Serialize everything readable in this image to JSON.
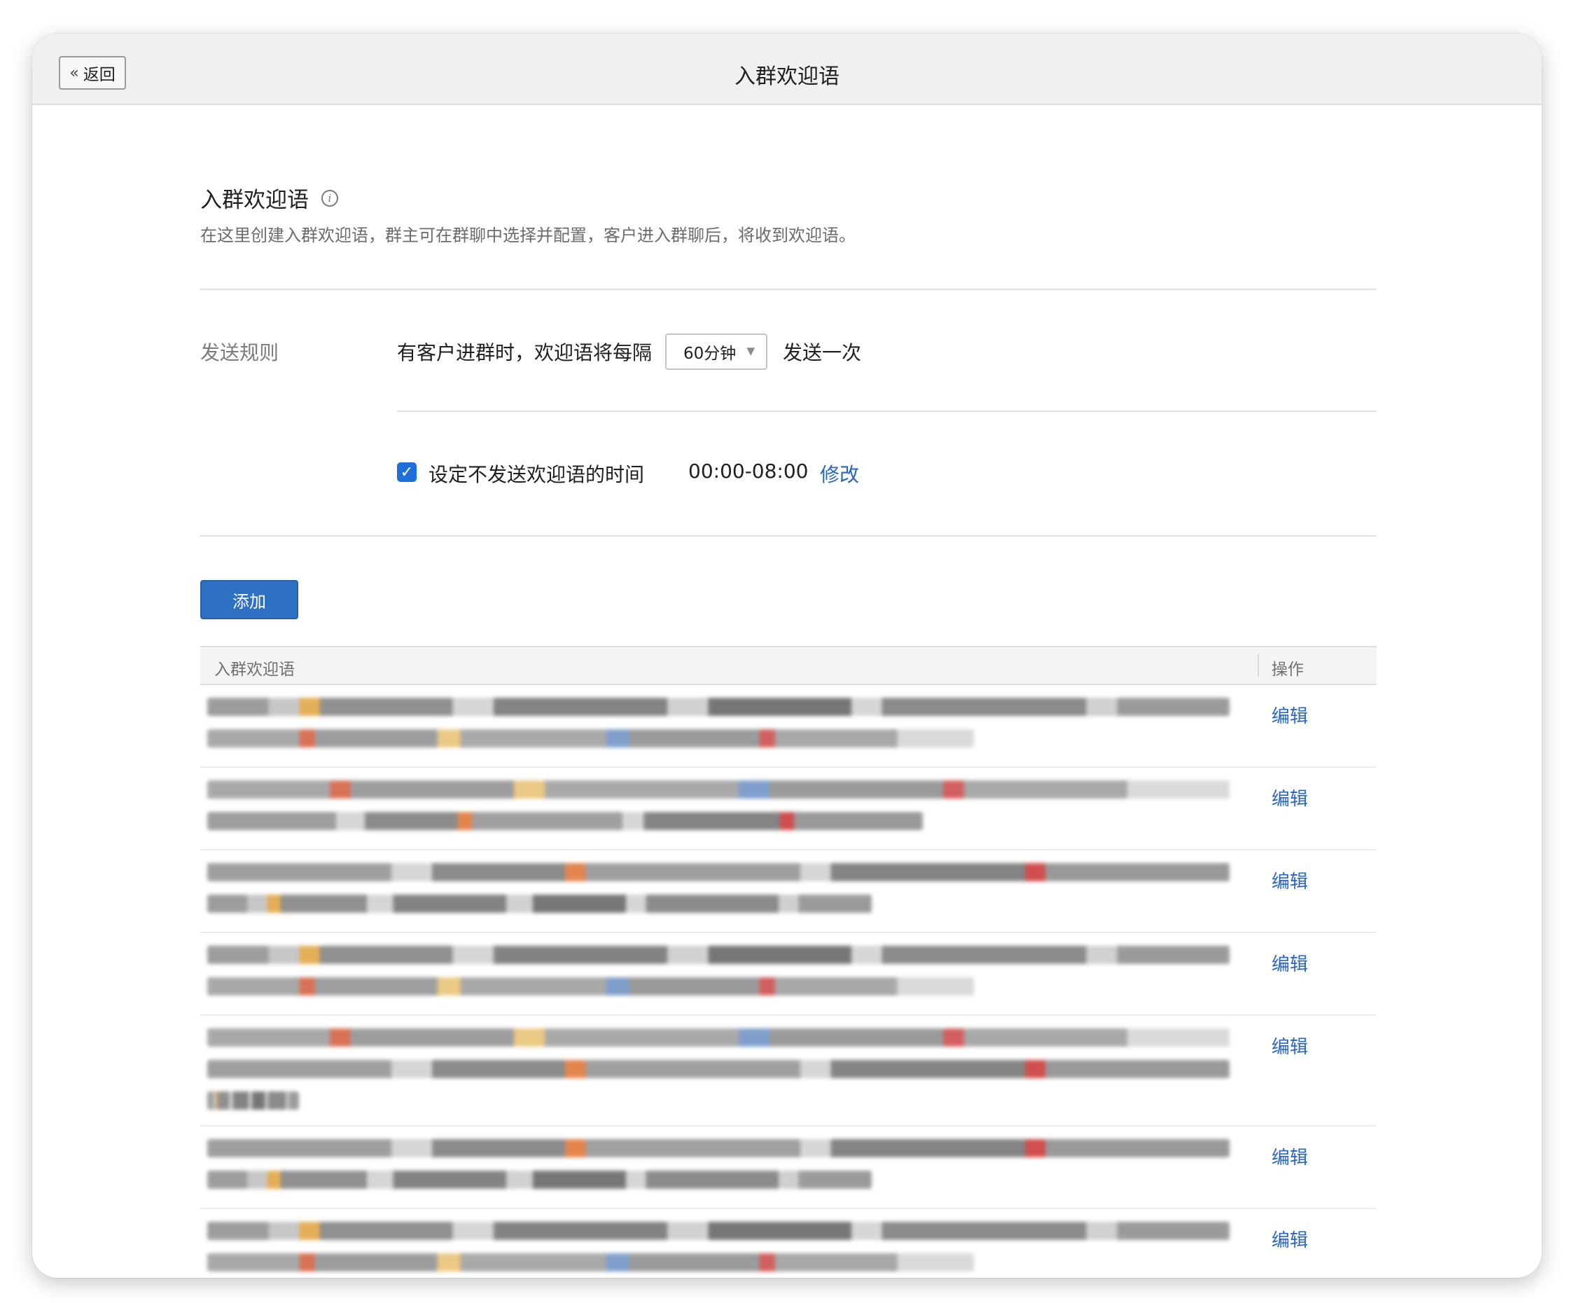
{
  "window": {
    "title": "入群欢迎语",
    "back_label": "返回"
  },
  "header": {
    "title": "入群欢迎语",
    "description": "在这里创建入群欢迎语，群主可在群聊中选择并配置，客户进入群聊后，将收到欢迎语。"
  },
  "send_rule": {
    "label": "发送规则",
    "text_before": "有客户进群时，欢迎语将每隔",
    "interval_selected": "60分钟",
    "text_after": "发送一次",
    "quiet_time": {
      "checked": true,
      "label": "设定不发送欢迎语的时间",
      "value": "00:00-08:00",
      "edit_label": "修改"
    }
  },
  "add_button_label": "添加",
  "table": {
    "columns": [
      "入群欢迎语",
      "操作"
    ],
    "rows": [
      {
        "text_lines": 2,
        "action": "编辑"
      },
      {
        "text_lines": 2,
        "action": "编辑"
      },
      {
        "text_lines": 2,
        "action": "编辑"
      },
      {
        "text_lines": 2,
        "action": "编辑"
      },
      {
        "text_lines": 3,
        "action": "编辑"
      },
      {
        "text_lines": 2,
        "action": "编辑"
      },
      {
        "text_lines": 2,
        "action": "编辑"
      }
    ]
  },
  "colors": {
    "accent": "#2766c2",
    "primary_button": "#2d70c4",
    "checkbox": "#1f6fd9"
  }
}
